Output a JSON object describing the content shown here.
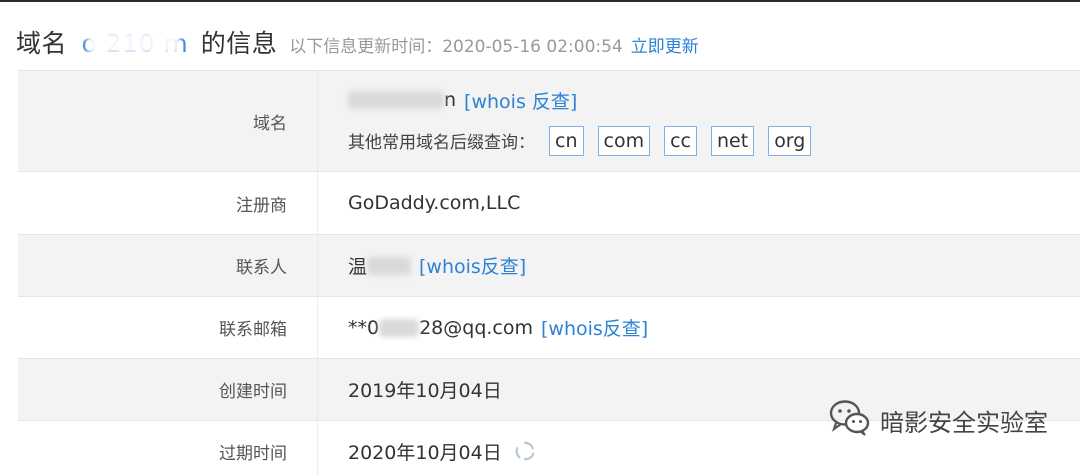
{
  "header": {
    "title_prefix": "域名",
    "title_domain": "o     210     m",
    "title_suffix": "的信息",
    "subtitle": "以下信息更新时间：2020-05-16 02:00:54",
    "update_link": "立即更新"
  },
  "rows": [
    {
      "label": "域名",
      "value_tail": "n",
      "whois_link": "[whois 反查]",
      "suffix_prompt": "其他常用域名后缀查询：",
      "suffixes": [
        "cn",
        "com",
        "cc",
        "net",
        "org"
      ]
    },
    {
      "label": "注册商",
      "value": "GoDaddy.com,LLC"
    },
    {
      "label": "联系人",
      "value_prefix": "温",
      "whois_link": "[whois反查]"
    },
    {
      "label": "联系邮箱",
      "value_prefix": "**0",
      "value_suffix": "28@qq.com",
      "whois_link": "[whois反查]"
    },
    {
      "label": "创建时间",
      "value": "2019年10月04日"
    },
    {
      "label": "过期时间",
      "value": "2020年10月04日",
      "icon": "refresh-icon"
    }
  ],
  "watermark": {
    "text": "暗影安全实验室",
    "icon": "wechat-icon"
  },
  "colors": {
    "link": "#2d82d6",
    "row_shade": "#f3f3f3",
    "suffix_border": "#7fb0e3"
  }
}
